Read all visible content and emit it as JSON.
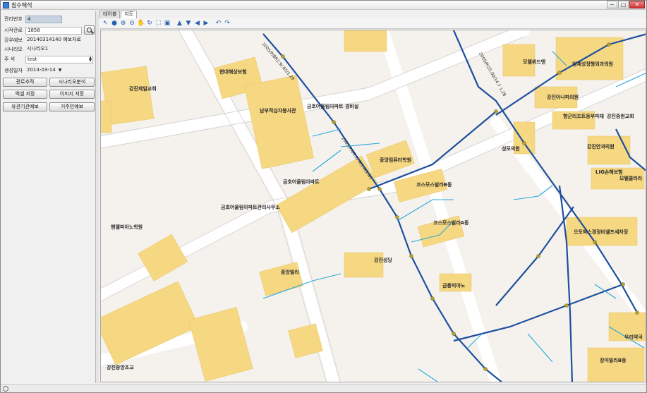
{
  "window": {
    "title": "침수해석",
    "buttons": [
      "─",
      "□",
      "✕"
    ]
  },
  "form": {
    "mgmt_no": {
      "label": "관리번호",
      "value": "4"
    },
    "start_pipe": {
      "label": "시작관로",
      "value": "1858"
    },
    "rain_forecast": {
      "label": "강우예보",
      "value": "20140314140 예보자료"
    },
    "scenario": {
      "label": "시나리오",
      "value": "시나리오1"
    },
    "note": {
      "label": "주 석",
      "value": "test"
    },
    "created_date": {
      "label": "생성일자",
      "value": "2014-03-14"
    }
  },
  "buttons": {
    "pipe_trace": "관로추적",
    "scenario_analysis": "시나리오분석",
    "excel_save": "엑셀 저장",
    "image_save": "이미지 저장",
    "agency_forecast": "유관기관예보",
    "resident_forecast": "거주민예보"
  },
  "tabs": [
    {
      "label": "테이블",
      "active": false
    },
    {
      "label": "지도",
      "active": true
    }
  ],
  "toolbar_icons": [
    "select-arrow-icon",
    "globe-icon",
    "zoom-in-icon",
    "zoom-out-icon",
    "pan-hand-icon",
    "refresh-icon",
    "full-extent-icon",
    "zoom-extent-icon",
    "arrow-up-icon",
    "arrow-down-icon",
    "arrow-left-icon",
    "arrow-right-icon",
    "undo-icon",
    "redo-icon"
  ],
  "map_labels": {
    "hyundai": "현대해상보험",
    "gangjin_church": "강진제일교회",
    "welfare": "남부적십자봉사관",
    "kumho_apt_guard": "금호어울림아파트 경비실",
    "motel": "모텔위드앤",
    "imjae": "임재성정형외과의원",
    "gangjin_ana": "강진아나파의원",
    "pharmacy": "향군리조트동부파재",
    "gangjin_church2": "강진중원교회",
    "gangjin_eye": "강진안과의원",
    "seongmo": "성모의원",
    "lig": "LIG손해보험",
    "motel_clara": "모텔클라라",
    "jungang_comp": "중앙컴퓨터학원",
    "kumho_apt": "금호어울림아파트",
    "cosmos_b": "코스모스빌라B동",
    "kumho_office": "금호어울림아파트관리사무소",
    "cosmos_a": "코스모스빌라A동",
    "handel": "핸델피아노학원",
    "oto": "오토박스경정비셀프세차장",
    "gangjin_sungdang": "강진성당",
    "jungang_villa": "중앙빌라",
    "geumsu": "금풍피아노",
    "gangjin_middle": "강진중앙초교",
    "woori": "우리약국",
    "jangmi": "장미빌라B동"
  },
  "pipe_labels": {
    "p1": "2005/P/BR2.9/.65/1.28",
    "p2": "2005/P/2S.00/14.7 1.28",
    "p3": "2005/P/BR.2/.9(1.6/1.81"
  },
  "colors": {
    "building": "#f6d882",
    "pipe_main": "#1e4f9e",
    "pipe_branch": "#27a8dc",
    "road": "#ffffff",
    "ground": "#f5f2ed"
  }
}
